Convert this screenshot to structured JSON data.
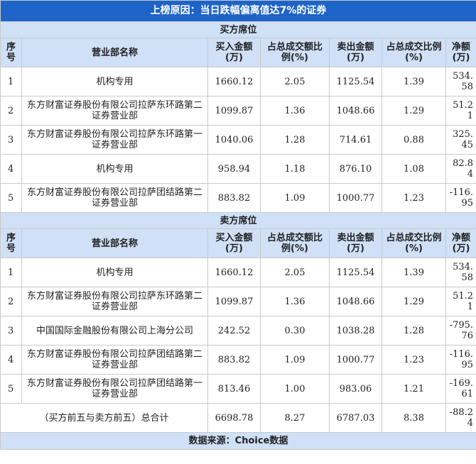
{
  "title": "上榜原因：当日跌幅偏离值达7%的证券",
  "buy_section_title": "买方席位",
  "sell_section_title": "卖方席位",
  "headers": {
    "idx": "序号",
    "name": "营业部名称",
    "buy_amount": "买入金额(万)",
    "buy_ratio": "占总成交额比例(%)",
    "sell_amount": "卖出金额(万)",
    "sell_ratio": "占总成交比例(%)",
    "net": "净额(万)"
  },
  "buy_rows": [
    {
      "idx": "1",
      "name": "机构专用",
      "buy_amount": "1660.12",
      "buy_ratio": "2.05",
      "sell_amount": "1125.54",
      "sell_ratio": "1.39",
      "net": "534.58"
    },
    {
      "idx": "2",
      "name": "东方财富证券股份有限公司拉萨东环路第二证券营业部",
      "buy_amount": "1099.87",
      "buy_ratio": "1.36",
      "sell_amount": "1048.66",
      "sell_ratio": "1.29",
      "net": "51.21"
    },
    {
      "idx": "3",
      "name": "东方财富证券股份有限公司拉萨东环路第一证券营业部",
      "buy_amount": "1040.06",
      "buy_ratio": "1.28",
      "sell_amount": "714.61",
      "sell_ratio": "0.88",
      "net": "325.45"
    },
    {
      "idx": "4",
      "name": "机构专用",
      "buy_amount": "958.94",
      "buy_ratio": "1.18",
      "sell_amount": "876.10",
      "sell_ratio": "1.08",
      "net": "82.84"
    },
    {
      "idx": "5",
      "name": "东方财富证券股份有限公司拉萨团结路第二证券营业部",
      "buy_amount": "883.82",
      "buy_ratio": "1.09",
      "sell_amount": "1000.77",
      "sell_ratio": "1.23",
      "net": "-116.95"
    }
  ],
  "sell_rows": [
    {
      "idx": "1",
      "name": "机构专用",
      "buy_amount": "1660.12",
      "buy_ratio": "2.05",
      "sell_amount": "1125.54",
      "sell_ratio": "1.39",
      "net": "534.58"
    },
    {
      "idx": "2",
      "name": "东方财富证券股份有限公司拉萨东环路第二证券营业部",
      "buy_amount": "1099.87",
      "buy_ratio": "1.36",
      "sell_amount": "1048.66",
      "sell_ratio": "1.29",
      "net": "51.21"
    },
    {
      "idx": "3",
      "name": "中国国际金融股份有限公司上海分公司",
      "buy_amount": "242.52",
      "buy_ratio": "0.30",
      "sell_amount": "1038.28",
      "sell_ratio": "1.28",
      "net": "-795.76"
    },
    {
      "idx": "4",
      "name": "东方财富证券股份有限公司拉萨团结路第二证券营业部",
      "buy_amount": "883.82",
      "buy_ratio": "1.09",
      "sell_amount": "1000.77",
      "sell_ratio": "1.23",
      "net": "-116.95"
    },
    {
      "idx": "5",
      "name": "东方财富证券股份有限公司拉萨团结路第一证券营业部",
      "buy_amount": "813.46",
      "buy_ratio": "1.00",
      "sell_amount": "983.06",
      "sell_ratio": "1.21",
      "net": "-169.61"
    }
  ],
  "total": {
    "label": "（买方前五与卖方前五）总合计",
    "buy_amount": "6698.78",
    "buy_ratio": "8.27",
    "sell_amount": "6787.03",
    "sell_ratio": "8.38",
    "net": "-88.24"
  },
  "footer": "数据来源：Choice数据",
  "colors": {
    "title_bg": "#1e63c7",
    "header_bg": "#cfe0f7",
    "border": "#c9c9c9"
  }
}
